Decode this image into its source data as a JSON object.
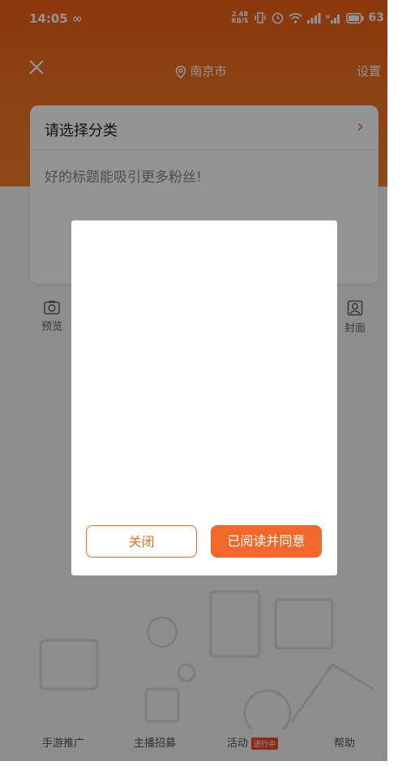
{
  "status_bar": {
    "time": "14:05",
    "infinity": "∞",
    "net_speed_top": "2.48",
    "net_speed_bottom": "KB/S",
    "battery": "63"
  },
  "navbar": {
    "location": "南京市",
    "settings": "设置"
  },
  "card": {
    "category_prompt": "请选择分类",
    "title_placeholder": "好的标题能吸引更多粉丝!"
  },
  "tools": {
    "preview": "预览",
    "cover": "封面"
  },
  "bottom_nav": {
    "items": [
      {
        "label": "手游推广"
      },
      {
        "label": "主播招募"
      },
      {
        "label": "活动",
        "badge": "进行中"
      },
      {
        "label": "帮助"
      }
    ]
  },
  "dialog": {
    "close_label": "关闭",
    "agree_label": "已阅读并同意"
  },
  "colors": {
    "accent": "#f26b1e",
    "header_gradient_top": "#f05f16",
    "badge": "#f04b2a"
  }
}
